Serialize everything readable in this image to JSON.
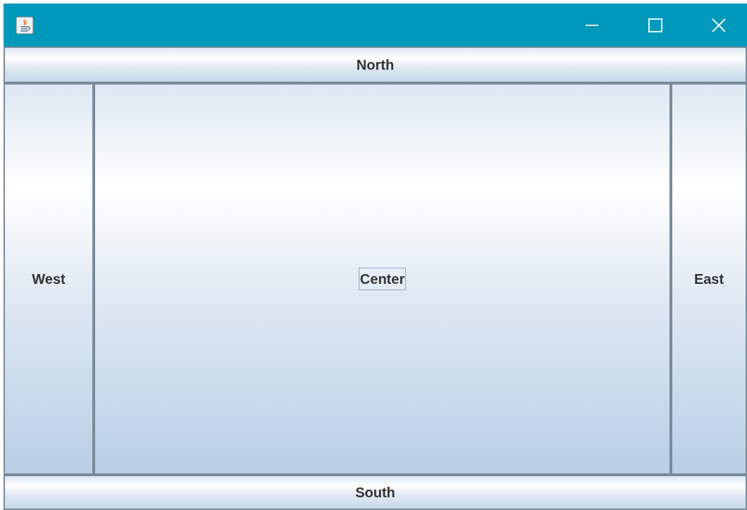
{
  "north": {
    "label": "North",
    "focused": false
  },
  "west": {
    "label": "West",
    "focused": false
  },
  "center": {
    "label": "Center",
    "focused": true
  },
  "east": {
    "label": "East",
    "focused": false
  },
  "south": {
    "label": "South",
    "focused": false
  }
}
